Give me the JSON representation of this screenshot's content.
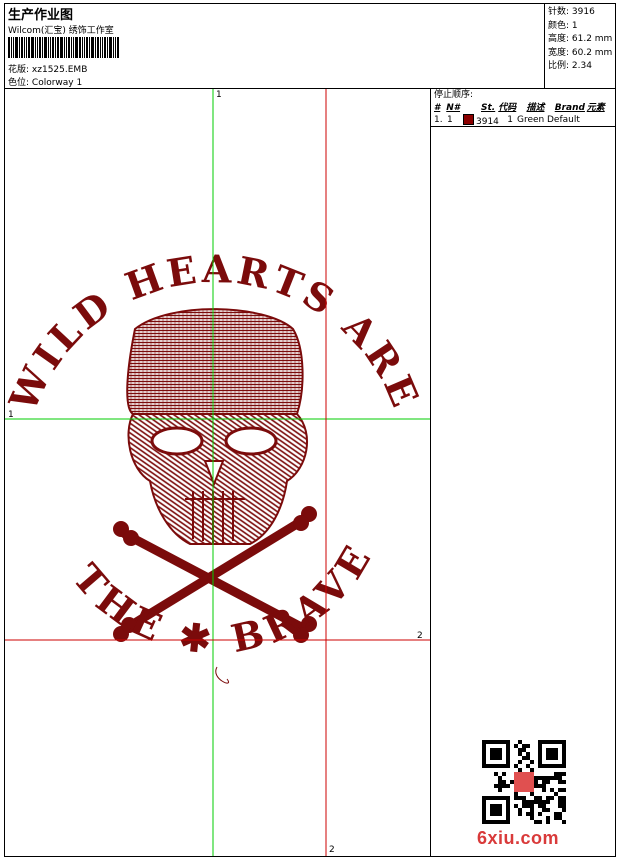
{
  "header": {
    "title": "生产作业图",
    "company": "Wilcom(汇宝) 绣饰工作室",
    "design_label": "花版:",
    "design_file": "xz1525.EMB",
    "colorway_label": "色位:",
    "colorway": "Colorway 1"
  },
  "stats": {
    "stitches": "针数: 3916",
    "colors": "颜色: 1",
    "height": "高度: 61.2 mm",
    "width": "宽度: 60.2 mm",
    "ratio": "比例: 2.34"
  },
  "stop_sequence": {
    "heading": "停止顺序:",
    "columns": [
      "#",
      "N#",
      "St.",
      "代码",
      "描述",
      "Brand",
      "元素"
    ],
    "rows": [
      {
        "index": "1.",
        "needle": "1",
        "stitches": "3914",
        "code": "1",
        "description": "Green",
        "brand": "Default",
        "element": ""
      }
    ]
  },
  "design": {
    "thread_color": "#7b0b0b",
    "text_top": "WILD HEARTS",
    "text_left": "WILD",
    "text_right": "ARE",
    "text_bottom": "THE BRAVE",
    "axis_marks": [
      "1",
      "1",
      "2",
      "2"
    ]
  },
  "watermark": {
    "text": "6xiu.com"
  },
  "colors": {
    "guide_green": "#00cc00",
    "guide_red": "#cc0000",
    "thread": "#7b0b0b",
    "logo": "#d93a3a"
  }
}
